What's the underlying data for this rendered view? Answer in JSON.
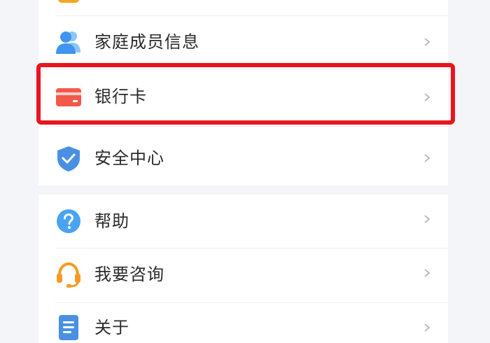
{
  "menu_top": {
    "items": [
      {
        "label": "家庭成员信息",
        "icon": "family-members-icon"
      },
      {
        "label": "银行卡",
        "icon": "bank-card-icon"
      },
      {
        "label": "安全中心",
        "icon": "security-shield-icon"
      }
    ]
  },
  "menu_bottom": {
    "items": [
      {
        "label": "帮助",
        "icon": "help-question-icon"
      },
      {
        "label": "我要咨询",
        "icon": "headset-icon"
      },
      {
        "label": "关于",
        "icon": "document-icon"
      }
    ]
  },
  "highlighted_item": "银行卡",
  "colors": {
    "highlight_border": "#e8151e",
    "icon_blue": "#4aa3f2",
    "icon_red": "#f2594b",
    "icon_orange": "#f59a23",
    "page_background": "#f4f5f9"
  }
}
